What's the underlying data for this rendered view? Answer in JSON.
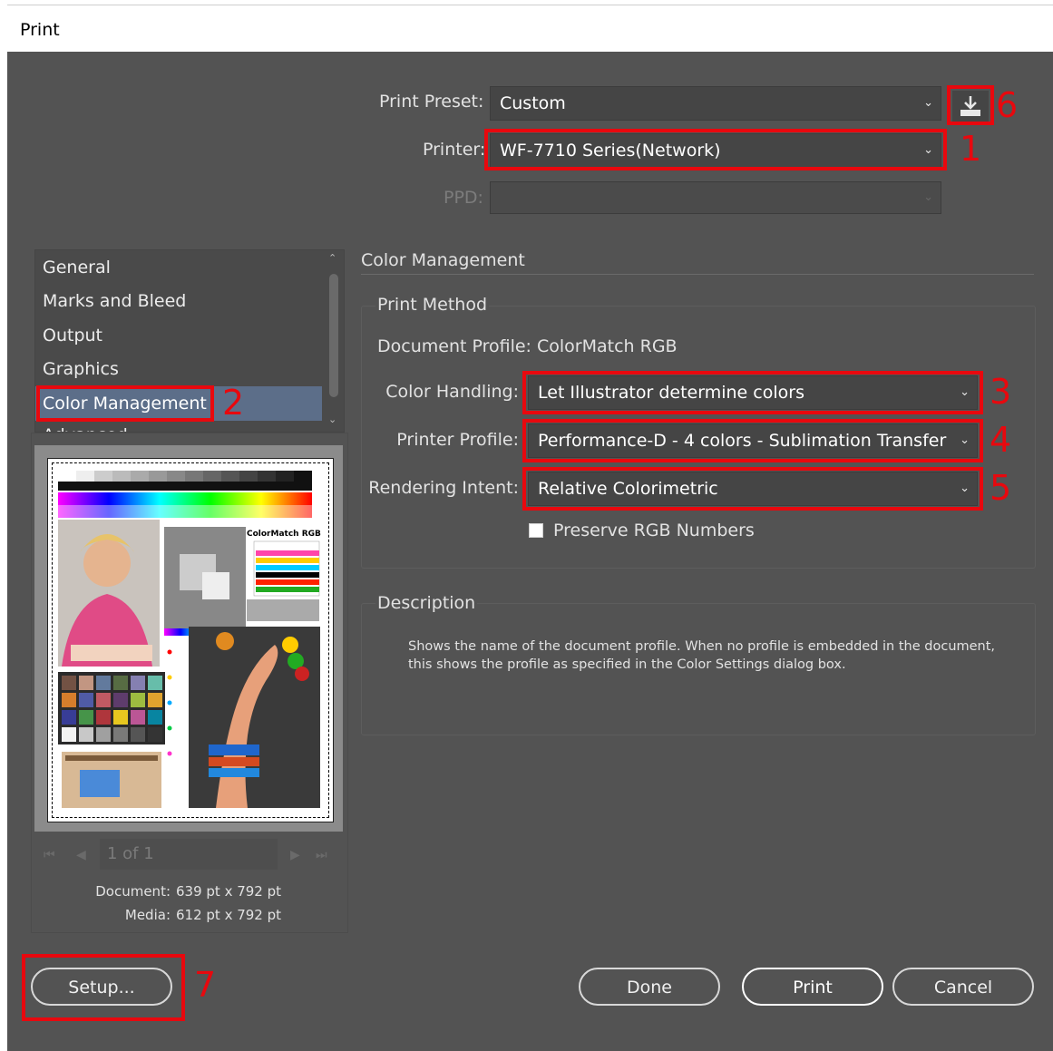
{
  "window": {
    "title": "Print"
  },
  "top": {
    "preset_label": "Print Preset:",
    "preset_value": "Custom",
    "printer_label": "Printer:",
    "printer_value": "WF-7710 Series(Network)",
    "ppd_label": "PPD:",
    "ppd_value": "",
    "save_preset_icon": "save-preset-icon"
  },
  "sidebar": {
    "items": [
      {
        "label": "General"
      },
      {
        "label": "Marks and Bleed"
      },
      {
        "label": "Output"
      },
      {
        "label": "Graphics"
      },
      {
        "label": "Color Management",
        "selected": true
      },
      {
        "label": "Advanced"
      }
    ]
  },
  "preview": {
    "page_indicator": "1 of 1",
    "document_label": "Document:",
    "document_value": "639 pt x 792 pt",
    "media_label": "Media:",
    "media_value": "612 pt x 792 pt",
    "thumbnail_caption": "ColorMatch RGB"
  },
  "main": {
    "section_title": "Color Management",
    "print_method": {
      "heading": "Print Method",
      "document_profile": "Document Profile: ColorMatch RGB",
      "color_handling_label": "Color Handling:",
      "color_handling_value": "Let Illustrator determine colors",
      "printer_profile_label": "Printer Profile:",
      "printer_profile_value": "Performance-D - 4 colors - Sublimation Transfer ...",
      "rendering_intent_label": "Rendering Intent:",
      "rendering_intent_value": "Relative Colorimetric",
      "preserve_rgb_label": "Preserve RGB Numbers",
      "preserve_rgb_checked": false
    },
    "description": {
      "heading": "Description",
      "text_line1": "Shows the name of the document profile. When no profile is embedded in the document,",
      "text_line2": "this shows the profile as specified in the Color Settings dialog box."
    }
  },
  "buttons": {
    "setup": "Setup...",
    "done": "Done",
    "print": "Print",
    "cancel": "Cancel"
  },
  "annotations": [
    "1",
    "2",
    "3",
    "4",
    "5",
    "6",
    "7"
  ],
  "colors": {
    "dialog_bg": "#535353",
    "highlight": "#e8080e",
    "selection": "#5c6e89"
  }
}
